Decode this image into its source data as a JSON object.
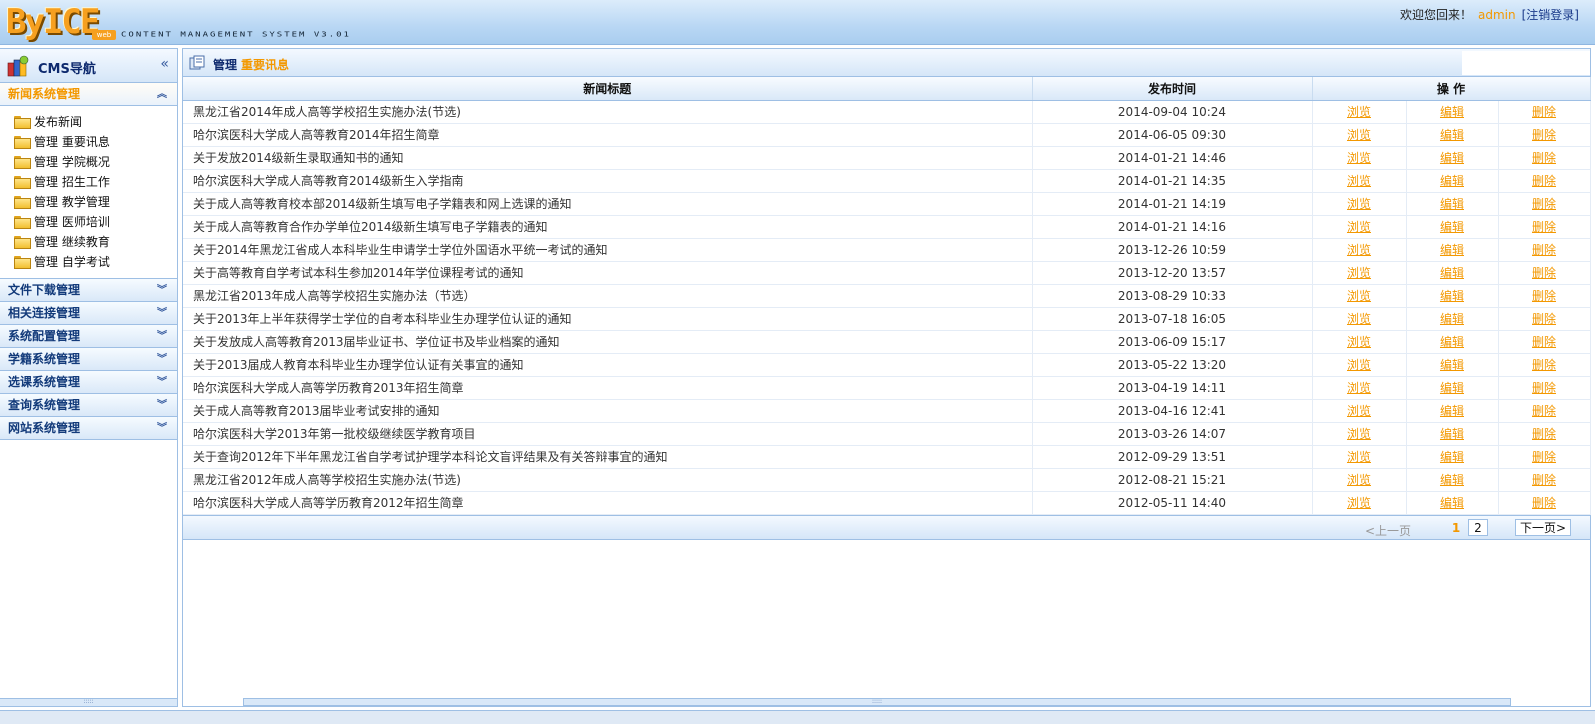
{
  "header": {
    "logo_text": "ByICE",
    "logo_sub": "web",
    "system_name": "content management system v3.01",
    "welcome_text": "欢迎您回来！",
    "username": "admin",
    "logout_label": "[注销登录]"
  },
  "sidebar": {
    "title": "CMS导航",
    "collapse_glyph": "«",
    "active_section": {
      "label": "新闻系统管理",
      "items": [
        {
          "label": "发布新闻"
        },
        {
          "label": "管理 重要讯息"
        },
        {
          "label": "管理 学院概况"
        },
        {
          "label": "管理 招生工作"
        },
        {
          "label": "管理 教学管理"
        },
        {
          "label": "管理 医师培训"
        },
        {
          "label": "管理 继续教育"
        },
        {
          "label": "管理 自学考试"
        }
      ]
    },
    "sections": [
      {
        "label": "文件下载管理"
      },
      {
        "label": "相关连接管理"
      },
      {
        "label": "系统配置管理"
      },
      {
        "label": "学籍系统管理"
      },
      {
        "label": "选课系统管理"
      },
      {
        "label": "查询系统管理"
      },
      {
        "label": "网站系统管理"
      }
    ]
  },
  "breadcrumb": {
    "prefix": "管理",
    "current": "重要讯息"
  },
  "table": {
    "columns": {
      "title": "新闻标题",
      "date": "发布时间",
      "ops": "操 作"
    },
    "ops": {
      "view": "浏览",
      "edit": "编辑",
      "delete": "删除"
    },
    "rows": [
      {
        "title": "黑龙江省2014年成人高等学校招生实施办法(节选)",
        "date": "2014-09-04 10:24"
      },
      {
        "title": "哈尔滨医科大学成人高等教育2014年招生简章",
        "date": "2014-06-05 09:30"
      },
      {
        "title": "关于发放2014级新生录取通知书的通知",
        "date": "2014-01-21 14:46"
      },
      {
        "title": "哈尔滨医科大学成人高等教育2014级新生入学指南",
        "date": "2014-01-21 14:35"
      },
      {
        "title": "关于成人高等教育校本部2014级新生填写电子学籍表和网上选课的通知",
        "date": "2014-01-21 14:19"
      },
      {
        "title": "关于成人高等教育合作办学单位2014级新生填写电子学籍表的通知",
        "date": "2014-01-21 14:16"
      },
      {
        "title": "关于2014年黑龙江省成人本科毕业生申请学士学位外国语水平统一考试的通知",
        "date": "2013-12-26 10:59"
      },
      {
        "title": "关于高等教育自学考试本科生参加2014年学位课程考试的通知",
        "date": "2013-12-20 13:57"
      },
      {
        "title": "黑龙江省2013年成人高等学校招生实施办法（节选）",
        "date": "2013-08-29 10:33"
      },
      {
        "title": "关于2013年上半年获得学士学位的自考本科毕业生办理学位认证的通知",
        "date": "2013-07-18 16:05"
      },
      {
        "title": "关于发放成人高等教育2013届毕业证书、学位证书及毕业档案的通知",
        "date": "2013-06-09 15:17"
      },
      {
        "title": "关于2013届成人教育本科毕业生办理学位认证有关事宜的通知",
        "date": "2013-05-22 13:20"
      },
      {
        "title": "哈尔滨医科大学成人高等学历教育2013年招生简章",
        "date": "2013-04-19 14:11"
      },
      {
        "title": "关于成人高等教育2013届毕业考试安排的通知",
        "date": "2013-04-16 12:41"
      },
      {
        "title": "哈尔滨医科大学2013年第一批校级继续医学教育项目",
        "date": "2013-03-26 14:07"
      },
      {
        "title": "关于查询2012年下半年黑龙江省自学考试护理学本科论文盲评结果及有关答辩事宜的通知",
        "date": "2012-09-29 13:51"
      },
      {
        "title": "黑龙江省2012年成人高等学校招生实施办法(节选)",
        "date": "2012-08-21 15:21"
      },
      {
        "title": "哈尔滨医科大学成人高等学历教育2012年招生简章",
        "date": "2012-05-11 14:40"
      }
    ]
  },
  "pager": {
    "prev_label": "<上一页",
    "current_page": "1",
    "page2": "2",
    "next_label": "下一页>"
  },
  "colors": {
    "accent": "#f39800",
    "nav_text": "#0e2a6e",
    "border": "#9ebfe4"
  }
}
